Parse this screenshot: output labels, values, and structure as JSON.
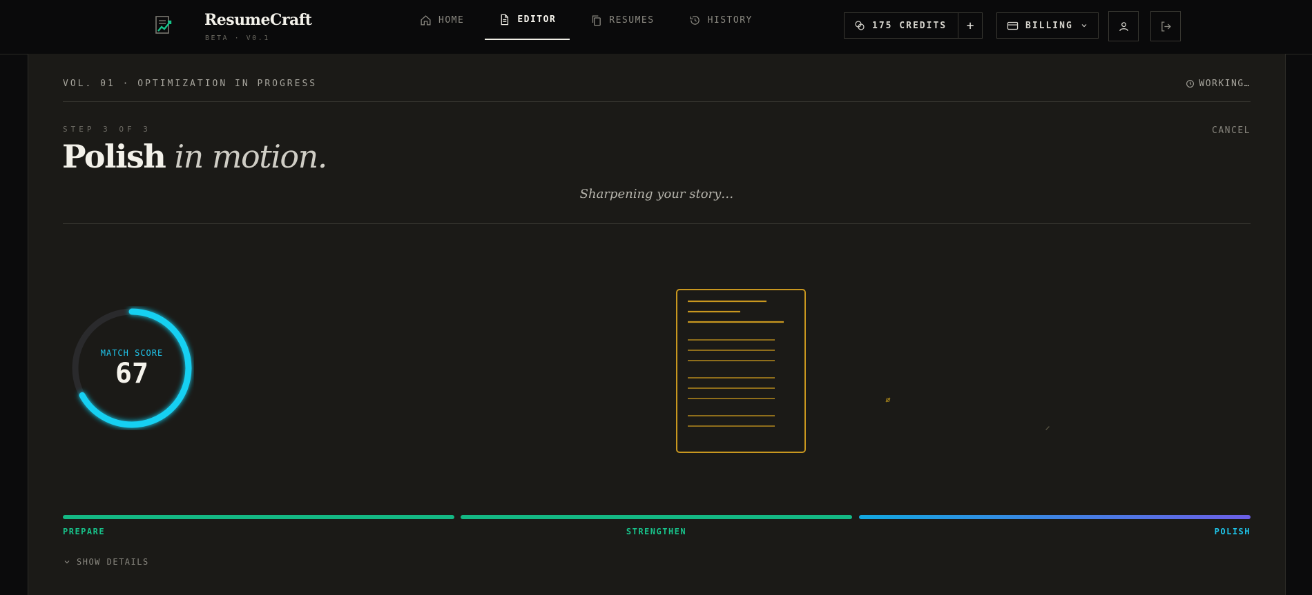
{
  "app": {
    "name": "ResumeCraft",
    "version": "BETA · V0.1",
    "logo_icon": "resume-chart-icon"
  },
  "nav": {
    "items": [
      {
        "label": "HOME",
        "icon": "home-icon"
      },
      {
        "label": "EDITOR",
        "icon": "document-icon",
        "active": true
      },
      {
        "label": "RESUMES",
        "icon": "copy-icon"
      },
      {
        "label": "HISTORY",
        "icon": "history-icon"
      }
    ]
  },
  "account": {
    "credits_label": "175 CREDITS",
    "add_credits": "+",
    "billing_label": "BILLING"
  },
  "meta": {
    "volume": "VOL. 01 · OPTIMIZATION IN PROGRESS",
    "status": "WORKING…"
  },
  "step": {
    "label": "STEP 3 OF 3",
    "cancel": "CANCEL",
    "title_bold": "Polish",
    "title_italic": "in motion.",
    "subtitle": "Sharpening your story…"
  },
  "score": {
    "label": "MATCH SCORE",
    "value": "67",
    "fraction": 0.67
  },
  "progress": {
    "stages": [
      {
        "label": "PREPARE",
        "state": "done"
      },
      {
        "label": "STRENGTHEN",
        "state": "done"
      },
      {
        "label": "POLISH",
        "state": "active"
      }
    ]
  },
  "details_toggle": "SHOW DETAILS",
  "colors": {
    "accent_cyan": "#16d0f2",
    "accent_green": "#14b884",
    "document_gold": "#c9971f",
    "panel_bg": "#1b1a17"
  }
}
